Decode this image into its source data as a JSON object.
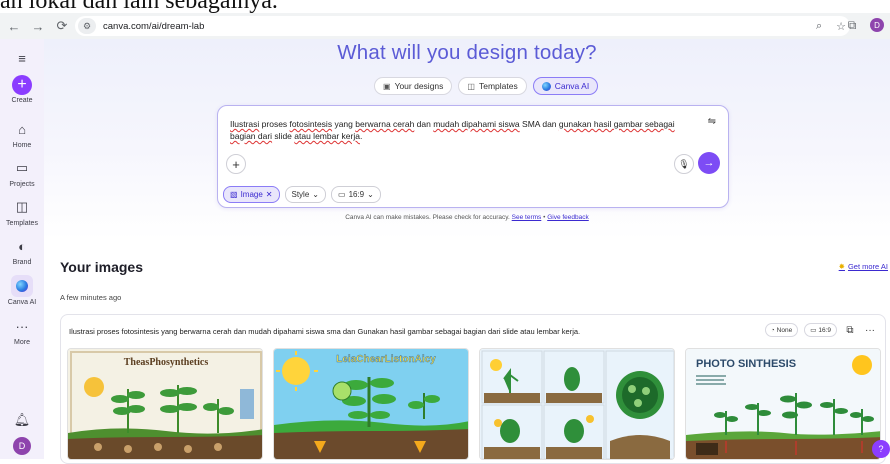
{
  "caption_fragment": "an lokal dan lain sebagainya.",
  "browser": {
    "url": "canva.com/ai/dream-lab",
    "profile_initial": "D"
  },
  "sidebar": {
    "items": [
      {
        "label": "Create",
        "icon": "plus-icon"
      },
      {
        "label": "Home",
        "icon": "home-icon"
      },
      {
        "label": "Projects",
        "icon": "folder-icon"
      },
      {
        "label": "Templates",
        "icon": "templates-icon"
      },
      {
        "label": "Brand",
        "icon": "brand-icon"
      },
      {
        "label": "Canva AI",
        "icon": "canva-ai-icon"
      },
      {
        "label": "More",
        "icon": "more-icon"
      }
    ],
    "avatar_initial": "D"
  },
  "hero": {
    "title": "What will you design today?",
    "tabs": [
      {
        "label": "Your designs",
        "icon": "designs-icon"
      },
      {
        "label": "Templates",
        "icon": "templates-icon"
      },
      {
        "label": "Canva AI",
        "icon": "canva-ai-icon",
        "active": true
      }
    ]
  },
  "prompt": {
    "text_parts": [
      {
        "t": "Ilustrasi",
        "ul": true
      },
      {
        "t": " proses ",
        "ul": false
      },
      {
        "t": "fotosintesis",
        "ul": true
      },
      {
        "t": " yang ",
        "ul": false
      },
      {
        "t": "berwarna cerah",
        "ul": true
      },
      {
        "t": " dan ",
        "ul": false
      },
      {
        "t": "mudah dipahami siswa",
        "ul": true
      },
      {
        "t": " SMA dan ",
        "ul": false
      },
      {
        "t": "gunakan hasil gambar sebagai bagian dari",
        "ul": true
      },
      {
        "t": " slide ",
        "ul": false
      },
      {
        "t": "atau lembar kerja",
        "ul": true
      },
      {
        "t": ".",
        "ul": false
      }
    ],
    "chips": {
      "image": "Image",
      "style": "Style",
      "ratio": "16:9"
    }
  },
  "disclaimer": {
    "text": "Canva AI can make mistakes. Please check for accuracy.",
    "terms": "See terms",
    "separator": "•",
    "feedback": "Give feedback"
  },
  "section": {
    "title": "Your images",
    "get_more": "Get more AI",
    "timestamp": "A few minutes ago"
  },
  "result": {
    "prompt": "Ilustrasi proses fotosintesis yang berwarna cerah dan mudah dipahami siswa sma dan Gunakan hasil gambar sebagai bagian dari slide atau lembar kerja.",
    "style_chip": "None",
    "ratio_chip": "16:9",
    "thumbnails": [
      {
        "title": "TheasPhosynthetics",
        "palette": {
          "sky": "#f4f1e4",
          "ground": "#6a4a2a",
          "accent": "#3d9b3a",
          "frame": "#d8c9a8"
        }
      },
      {
        "title": "LeiaChearListonAicy",
        "palette": {
          "sky": "#7fd0f0",
          "ground": "#6b4a2c",
          "accent": "#3caa3c",
          "frame": "#4fb9e3"
        }
      },
      {
        "title": "",
        "palette": {
          "sky": "#e9f3fb",
          "ground": "#8a6a40",
          "accent": "#2f8f3a",
          "frame": "#cfe6f3"
        }
      },
      {
        "title": "PHOTO SINTHESIS",
        "palette": {
          "sky": "#e9f5fb",
          "ground": "#7a4f2c",
          "accent": "#2e8c3a",
          "frame": "#f3f8fb"
        }
      }
    ]
  },
  "colors": {
    "brand_purple": "#8b3dff",
    "headline": "#5b5bd6",
    "link": "#3b2ad0"
  }
}
